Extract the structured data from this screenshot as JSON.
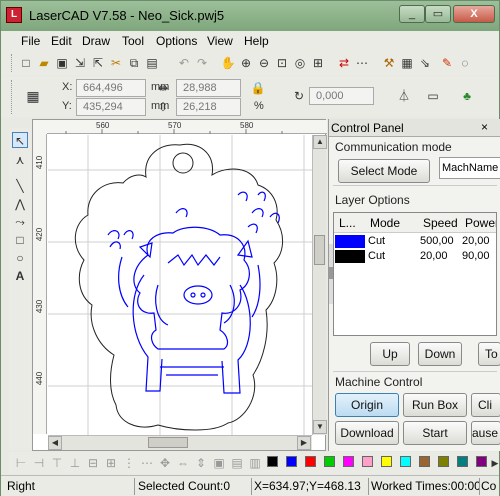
{
  "window": {
    "title": "LaserCAD V7.58  -  Neo_Sick.pwj5",
    "app_icon": "L"
  },
  "titlebar_buttons": {
    "minimize": "_",
    "maximize": "▭",
    "close": "X"
  },
  "menu": [
    {
      "label": "File"
    },
    {
      "label": "Edit"
    },
    {
      "label": "Draw"
    },
    {
      "label": "Tool"
    },
    {
      "label": "Options"
    },
    {
      "label": "View"
    },
    {
      "label": "Help"
    }
  ],
  "coords": {
    "x_label": "X:",
    "x_value": "664,496",
    "y_label": "Y:",
    "y_value": "435,294",
    "w_value": "28,988",
    "h_value": "26,218",
    "unit": "mm",
    "pct": "%",
    "angle_value": "0,000"
  },
  "ruler": {
    "h_ticks": [
      "560",
      "570",
      "580"
    ],
    "v_ticks": [
      "410",
      "420",
      "430",
      "440"
    ]
  },
  "panel": {
    "title": "Control Panel",
    "comm_mode": "Communication mode",
    "select_mode": "Select Mode",
    "mach_name": "MachName",
    "layer_options": "Layer Options",
    "columns": [
      "L...",
      "Mode",
      "Speed",
      "Power"
    ],
    "layers": [
      {
        "color": "#0000ff",
        "mode": "Cut",
        "speed": "500,00",
        "power": "20,00"
      },
      {
        "color": "#000000",
        "mode": "Cut",
        "speed": "20,00",
        "power": "90,00"
      }
    ],
    "up": "Up",
    "down": "Down",
    "top": "To",
    "machine_control": "Machine Control",
    "origin": "Origin",
    "run_box": "Run Box",
    "cl": "Cli",
    "download": "Download",
    "start": "Start",
    "pause": "ause"
  },
  "palette": [
    "#000000",
    "#0000ff",
    "#ff0000",
    "#00cc00",
    "#ff00ff",
    "#ffa0c8",
    "#ffff00",
    "#00ffff",
    "#996633",
    "#808000",
    "#008080",
    "#800080",
    "#0000a0"
  ],
  "status": {
    "mode": "Right",
    "selected": "Selected Count:0",
    "cursor": "X=634.97;Y=468.13",
    "worked": "Worked Times:00:00",
    "co": "Co"
  }
}
